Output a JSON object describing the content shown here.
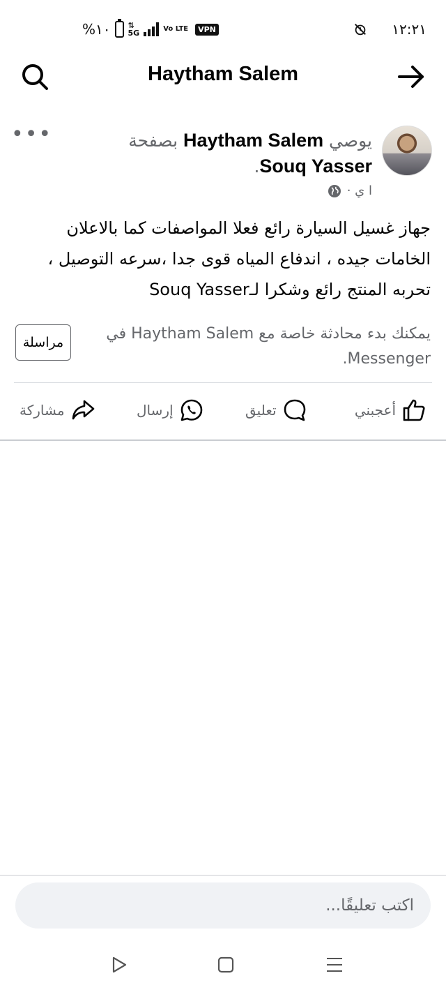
{
  "status_bar": {
    "battery": "%١٠",
    "network": "5G",
    "volte": "Vo LTE",
    "vpn": "VPN",
    "time": "١٢:٢١"
  },
  "header": {
    "title": "Haytham Salem",
    "search_icon": "search-icon",
    "back_icon": "arrow-right-icon"
  },
  "post": {
    "heading_prefix": "يوصي ",
    "author": "Haytham Salem",
    "heading_middle": " بصفحة ",
    "page_name": "Souq Yasser",
    "heading_suffix": ".",
    "time": "ا ي ·",
    "body": "جهاز غسيل السيارة رائع فعلا المواصفات كما بالاعلان الخامات جيده ، اندفاع المياه قوى جدا ،سرعه التوصيل ، تحربه المنتج رائع وشكرا لـSouq Yasser",
    "more_label": "•••"
  },
  "messenger": {
    "text": "يمكنك بدء محادثة خاصة مع Haytham Salem في Messenger.",
    "button_label": "مراسلة"
  },
  "actions": {
    "like": "أعجبني",
    "comment": "تعليق",
    "send": "إرسال",
    "share": "مشاركة"
  },
  "comment_input": {
    "placeholder": "اكتب تعليقًا..."
  }
}
